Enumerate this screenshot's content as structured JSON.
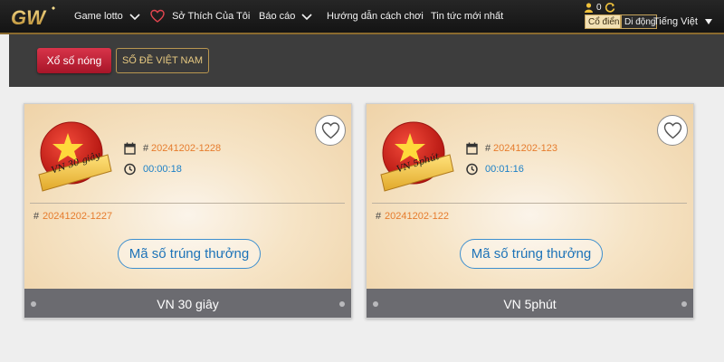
{
  "header": {
    "nav": {
      "game_lotto": "Game lotto",
      "favorites": "Sở Thích Của Tôi",
      "reports": "Báo cáo",
      "guide": "Hướng dẫn cách chơi",
      "news": "Tin tức mới nhất"
    },
    "balance": "0",
    "mode": {
      "classic": "Cổ điển",
      "mobile": "Di động"
    },
    "language": "Tiếng Việt",
    "icons": {
      "logo": "gw-logo",
      "favorites": "heart-icon",
      "user": "user-icon",
      "refresh": "refresh-icon",
      "dropdown": "chevron-down-icon"
    }
  },
  "subnav": {
    "hot": "Xổ số nóng",
    "vietnam": "SỐ ĐỀ VIỆT NAM"
  },
  "cards": [
    {
      "badge_label": "VN 30 giây",
      "current_issue": "20241202-1228",
      "countdown": "00:00:18",
      "previous_issue": "20241202-1227",
      "hash": "#",
      "winning_button": "Mã số trúng thưởng",
      "footer_title": "VN 30 giây"
    },
    {
      "badge_label": "VN 5phút",
      "current_issue": "20241202-123",
      "countdown": "00:01:16",
      "previous_issue": "20241202-122",
      "hash": "#",
      "winning_button": "Mã số trúng thưởng",
      "footer_title": "VN 5phút"
    }
  ],
  "colors": {
    "nav_bg": "#1c1c1c",
    "accent_gold": "#c4a25a",
    "hot_red": "#c22239",
    "issue_orange": "#e67c2d",
    "timer_blue": "#1c80c7",
    "footer_gray": "#6b6b70"
  }
}
